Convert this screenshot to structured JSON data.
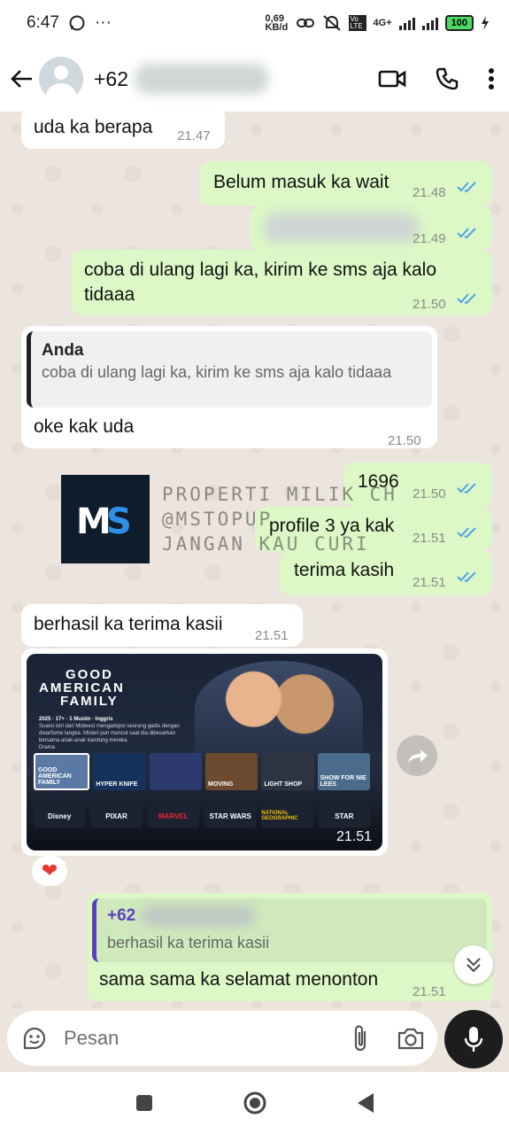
{
  "status_bar": {
    "time": "6:47",
    "more": "···",
    "net_speed": "0,69 KB/d",
    "network": "4G+",
    "volte": "Vo LTE",
    "battery": "100"
  },
  "header": {
    "contact_prefix": "+62",
    "video_call_icon": "video-camera-icon",
    "voice_call_icon": "phone-icon",
    "menu_icon": "kebab-menu-icon"
  },
  "messages": [
    {
      "dir": "in",
      "text": "uda ka berapa",
      "time": "21.47"
    },
    {
      "dir": "out",
      "text": "Belum masuk ka wait",
      "time": "21.48"
    },
    {
      "dir": "out",
      "text": "",
      "time": "21.49"
    },
    {
      "dir": "out",
      "text": "coba di ulang lagi ka, kirim ke sms aja kalo tidaaa",
      "time": "21.50"
    },
    {
      "dir": "in",
      "quote_author": "Anda",
      "quote_text": "coba di ulang lagi ka, kirim ke sms aja kalo tidaaa",
      "text": "oke kak uda",
      "time": "21.50"
    },
    {
      "dir": "out",
      "text": "1696",
      "time": "21.50"
    },
    {
      "dir": "out",
      "text": "profile 3 ya kak",
      "time": "21.51"
    },
    {
      "dir": "out",
      "text": "terima kasih",
      "time": "21.51"
    },
    {
      "dir": "in",
      "text": "berhasil ka terima kasii",
      "time": "21.51"
    },
    {
      "dir": "in",
      "kind": "image",
      "time": "21.51",
      "reaction": "❤"
    },
    {
      "dir": "out",
      "quote_author": "+62",
      "quote_text": "berhasil ka terima kasii",
      "text": "sama sama ka selamat menonton",
      "time": "21.51"
    }
  ],
  "watermark": {
    "logo_text": "MS",
    "line1": "PROPERTI MILIK CH",
    "line2": "@MSTOPUP",
    "line3": "JANGAN KAU CURI"
  },
  "tv_image": {
    "show_title_1": "GOOD",
    "show_title_2": "AMERICAN",
    "show_title_3": "FAMILY",
    "meta": "2025 · 17+ · 1 Musim · Inggris",
    "description": "Suami istri dari Midwest mengadopsi seorang gadis dengan dwarfisme langka. Misteri pun muncul saat dia dibesarkan bersama anak-anak kandung mereka.",
    "genre": "Drama",
    "tiles": [
      "GOOD AMERICAN FAMILY",
      "HYPER KNIFE",
      "",
      "MOVING",
      "LIGHT SHOP",
      "SHOW FOR NIE LEES"
    ],
    "brands": [
      "Disney",
      "PIXAR",
      "MARVEL",
      "STAR WARS",
      "NATIONAL GEOGRAPHIC",
      "STAR"
    ]
  },
  "composer": {
    "placeholder": "Pesan",
    "emoji_icon": "emoji-sticker-icon",
    "attach_icon": "paperclip-icon",
    "camera_icon": "camera-icon",
    "mic_icon": "microphone-icon"
  },
  "colors": {
    "outgoing": "#dcf8c6",
    "incoming": "#ffffff",
    "read_ticks": "#4fa3e8",
    "background": "#ebe5dd"
  }
}
